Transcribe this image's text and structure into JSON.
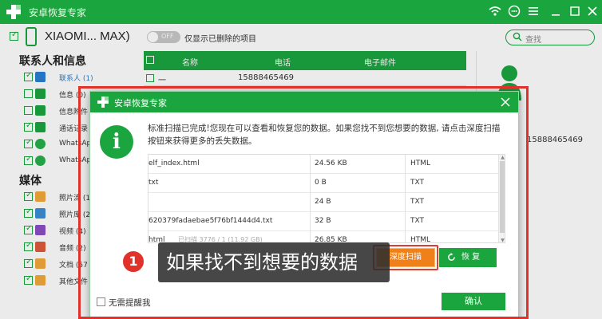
{
  "app": {
    "title": "安卓恢复专家"
  },
  "device": {
    "name": "XIAOMI... MAX)",
    "toggle_label": "OFF",
    "only_deleted_label": "仅显示已删除的项目"
  },
  "search": {
    "placeholder": "查找"
  },
  "sidebar": {
    "contacts_heading": "联系人和信息",
    "media_heading": "媒体",
    "contact_items": [
      {
        "label": "联系人 (1)",
        "color": "#2a7fd4"
      },
      {
        "label": "信息 (0)",
        "color": "#1ba53f"
      },
      {
        "label": "信息附件",
        "color": "#1ba53f"
      },
      {
        "label": "通话记录",
        "color": "#1ba53f"
      },
      {
        "label": "WhatsAp",
        "color": "#25b04a"
      },
      {
        "label": "WhatsAp",
        "color": "#25b04a"
      }
    ],
    "media_items": [
      {
        "label": "照片流 (1",
        "color": "#f2a93b"
      },
      {
        "label": "照片库 (22",
        "color": "#3b8ed8"
      },
      {
        "label": "视频 (4)",
        "color": "#8a4fc4"
      },
      {
        "label": "音频 (2)",
        "color": "#e05a3a"
      },
      {
        "label": "文档 (57",
        "color": "#f2a93b"
      },
      {
        "label": "其他文件",
        "color": "#f2a93b"
      }
    ]
  },
  "table": {
    "headers": [
      "名称",
      "电话",
      "电子邮件"
    ],
    "row1_name": "一",
    "row1_phone": "15888465469"
  },
  "right_panel": {
    "phone": "15888465469"
  },
  "dialog": {
    "title": "安卓恢复专家",
    "message": "标准扫描已完成!您现在可以查看和恢复您的数据。如果您找不到您想要的数据, 请点击深度扫描按钮来获得更多的丢失数据。",
    "files": [
      {
        "name": "elf_index.html",
        "size": "24.56 KB",
        "type": "HTML"
      },
      {
        "name": "txt",
        "size": "0 B",
        "type": "TXT"
      },
      {
        "name": "",
        "size": "24 B",
        "type": "TXT"
      },
      {
        "name": "620379fadaebae5f76bf1444d4.txt",
        "size": "32 B",
        "type": "TXT"
      },
      {
        "name": "html",
        "size": "26.85 KB",
        "type": "HTML"
      }
    ],
    "progress_text": "已扫描 3776 / 1 (11.92 GB)",
    "deep_scan_label": "深度扫描",
    "recover_label": "恢 复",
    "no_remind_label": "无需提醒我",
    "ok_label": "确认"
  },
  "callout": {
    "step": "1",
    "text": "如果找不到想要的数据"
  },
  "colors": {
    "brand_green": "#1ba53f",
    "orange": "#f0801a",
    "highlight_red": "#e0312a"
  }
}
